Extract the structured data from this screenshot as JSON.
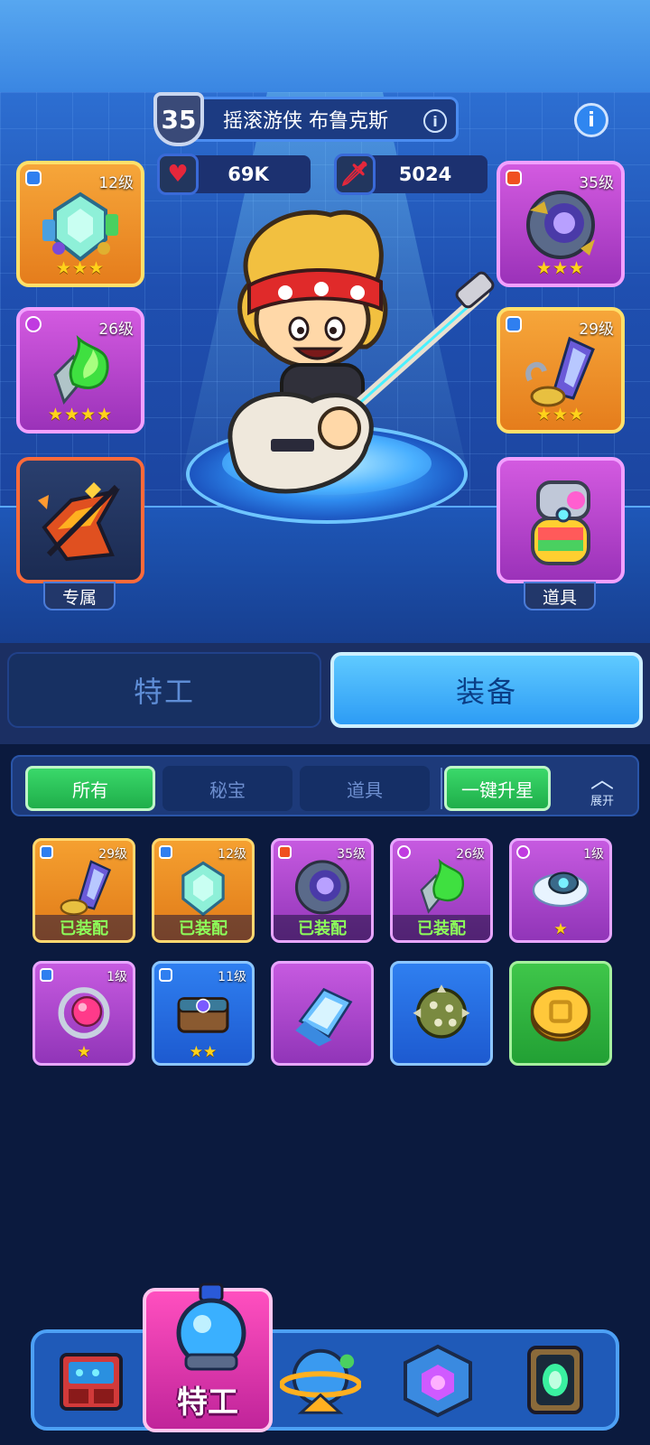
{
  "hero": {
    "level": "35",
    "name": "摇滚游侠 布鲁克斯",
    "hp": "69K",
    "attack": "5024",
    "slots_left": [
      {
        "level": "12级",
        "stars": "★★★",
        "tier": "blue",
        "item": "crystal-gem"
      },
      {
        "level": "26级",
        "stars": "★★★★",
        "tier": "pink",
        "item": "green-flame-blade"
      },
      {
        "label": "专属",
        "item": "rock-guitar"
      }
    ],
    "slots_right": [
      {
        "level": "35级",
        "stars": "★★★",
        "tier": "fire",
        "item": "void-orb"
      },
      {
        "level": "29级",
        "stars": "★★★",
        "tier": "blue",
        "item": "crystal-spike"
      },
      {
        "label": "道具",
        "item": "rainbow-canister"
      }
    ]
  },
  "main_tabs": {
    "agent": "特工",
    "equipment": "装备"
  },
  "filters": {
    "all": "所有",
    "treasure": "秘宝",
    "items": "道具",
    "upgrade_all": "一键升星",
    "expand": "展开"
  },
  "inventory": {
    "equipped_label": "已装配",
    "row1": [
      {
        "level": "29级",
        "tier": "blue",
        "equipped": true,
        "color": "orange",
        "item": "crystal-spike"
      },
      {
        "level": "12级",
        "tier": "blue",
        "equipped": true,
        "color": "orange",
        "item": "crystal-gem"
      },
      {
        "level": "35级",
        "tier": "fire",
        "equipped": true,
        "color": "purple",
        "item": "void-orb"
      },
      {
        "level": "26级",
        "tier": "pink",
        "equipped": true,
        "color": "purple",
        "item": "green-flame-blade"
      },
      {
        "level": "1级",
        "tier": "pink",
        "stars": "★",
        "color": "purple",
        "item": "feather-ring"
      }
    ],
    "row2": [
      {
        "level": "1级",
        "tier": "blue",
        "stars": "★",
        "color": "purple",
        "item": "crimson-orb-ring"
      },
      {
        "level": "11级",
        "tier": "blue",
        "stars": "★★",
        "color": "blue",
        "item": "treasure-chest"
      },
      {
        "color": "purple",
        "item": "crystal-cards"
      },
      {
        "color": "blue",
        "item": "spiked-mine"
      },
      {
        "color": "green",
        "item": "gold-coin"
      }
    ]
  },
  "bottom_nav": {
    "active_label": "特工",
    "items": [
      "shop-icon",
      "agent-icon",
      "planet-icon",
      "cube-icon",
      "portal-icon"
    ]
  },
  "colors": {
    "accent": "#2d9cf5",
    "equipped_text": "#8dff5a",
    "star": "#ffd21a"
  }
}
